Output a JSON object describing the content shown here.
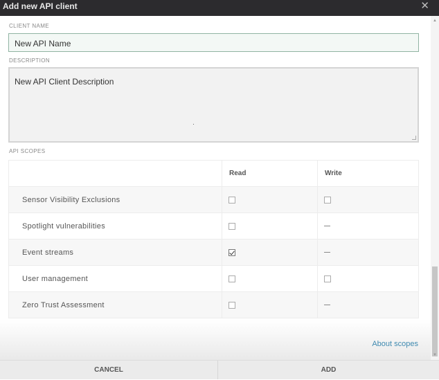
{
  "dialog": {
    "title": "Add new API client",
    "close_icon": "close-icon"
  },
  "client_name": {
    "label": "CLIENT NAME",
    "value": "New API Name"
  },
  "description": {
    "label": "DESCRIPTION",
    "value": "New API Client Description"
  },
  "scopes": {
    "label": "API SCOPES",
    "columns": [
      "",
      "Read",
      "Write"
    ],
    "rows": [
      {
        "name": "Sensor Visibility Exclusions",
        "read": false,
        "write": false
      },
      {
        "name": "Spotlight vulnerabilities",
        "read": false,
        "write": null
      },
      {
        "name": "Event streams",
        "read": true,
        "write": null
      },
      {
        "name": "User management",
        "read": false,
        "write": false
      },
      {
        "name": "Zero Trust Assessment",
        "read": false,
        "write": null
      }
    ]
  },
  "about_link": "About scopes",
  "footer": {
    "cancel": "CANCEL",
    "add": "ADD"
  }
}
